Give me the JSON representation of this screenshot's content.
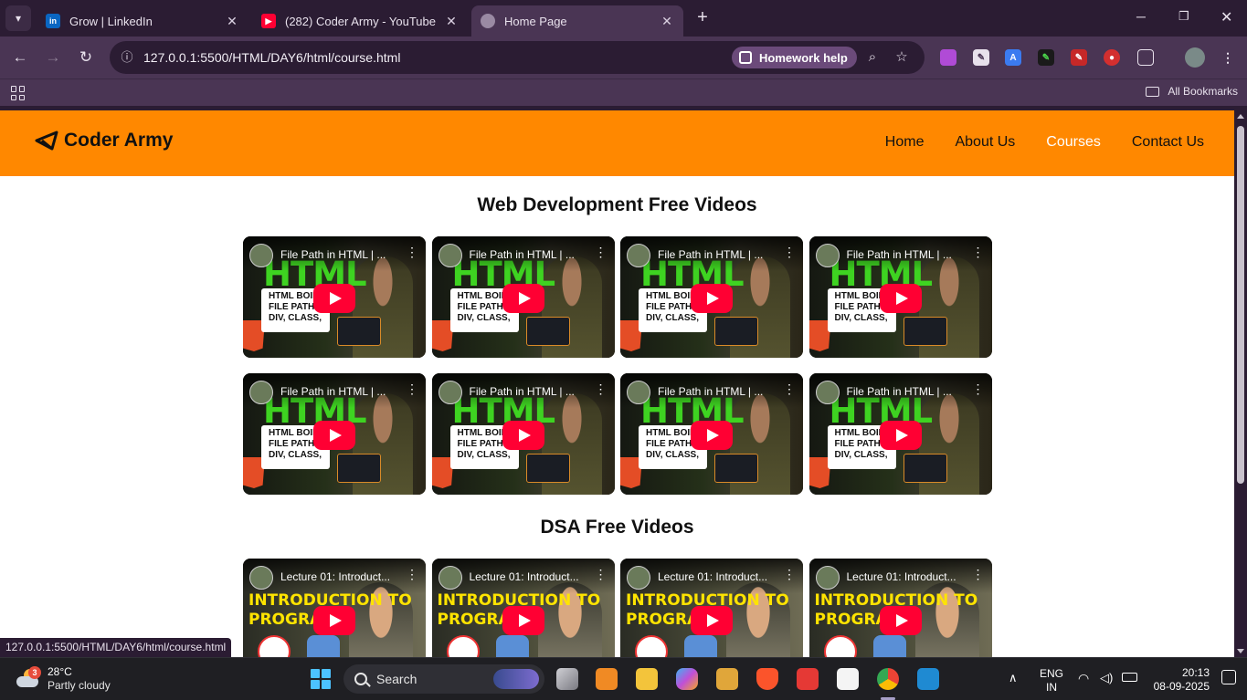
{
  "browser": {
    "tabs": [
      {
        "title": "Grow | LinkedIn",
        "favicon": "linkedin-icon",
        "color": "#0a66c2",
        "active": false
      },
      {
        "title": "(282) Coder Army - YouTube",
        "favicon": "youtube-icon",
        "color": "#ff0033",
        "active": false
      },
      {
        "title": "Home Page",
        "favicon": "globe-icon",
        "color": "#9a8aa3",
        "active": true
      }
    ],
    "url": "127.0.0.1:5500/HTML/DAY6/html/course.html",
    "homework_chip": "Homework help",
    "bookmarks_label": "All Bookmarks",
    "status_url": "127.0.0.1:5500/HTML/DAY6/html/course.html"
  },
  "site": {
    "brand": "Coder Army",
    "accent_color": "#ff8800",
    "nav": [
      "Home",
      "About Us",
      "Courses",
      "Contact Us"
    ],
    "current_nav": "Courses"
  },
  "sections": [
    {
      "title": "Web Development Free Videos",
      "video_title": "File Path in HTML | ...",
      "thumb_big": "HTML",
      "thumb_lines": [
        "HTML BOILE",
        "FILE PATH",
        "DIV, CLASS, ID"
      ],
      "count": 8
    },
    {
      "title": "DSA Free Videos",
      "video_title": "Lecture 01: Introduct...",
      "thumb_lines": [
        "INTRODUCTION TO",
        "PROGRA   NG"
      ],
      "count": 4
    }
  ],
  "taskbar": {
    "weather_badge": "3",
    "temperature": "28°C",
    "condition": "Partly cloudy",
    "search": "Search",
    "lang_top": "ENG",
    "lang_bottom": "IN",
    "time": "20:13",
    "date": "08-09-2025"
  }
}
